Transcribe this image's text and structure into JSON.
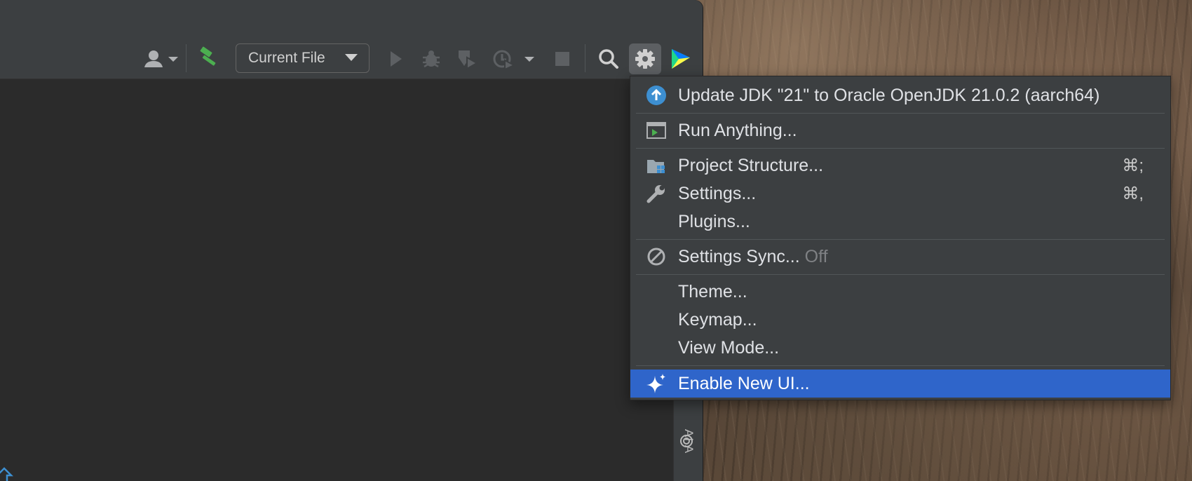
{
  "toolbar": {
    "run_config_label": "Current File",
    "icons": [
      "account-icon",
      "hammer-icon",
      "run-icon",
      "debug-icon",
      "coverage-icon",
      "profile-icon",
      "stop-icon",
      "search-icon",
      "gear-icon",
      "toolbox-icon"
    ]
  },
  "menu": {
    "items": [
      {
        "label": "Update JDK \"21\" to Oracle OpenJDK 21.0.2 (aarch64)",
        "icon": "update-arrow-icon"
      },
      {
        "label": "Run Anything...",
        "icon": "run-anything-icon"
      },
      {
        "label": "Project Structure...",
        "icon": "project-structure-icon",
        "shortcut": "⌘;"
      },
      {
        "label": "Settings...",
        "icon": "wrench-icon",
        "shortcut": "⌘,"
      },
      {
        "label": "Plugins..."
      },
      {
        "label": "Settings Sync...",
        "icon": "disabled-icon",
        "suffix": "Off"
      },
      {
        "label": "Theme..."
      },
      {
        "label": "Keymap..."
      },
      {
        "label": "View Mode..."
      },
      {
        "label": "Enable New UI...",
        "icon": "sparkle-icon"
      }
    ]
  },
  "side_panel": {
    "label": "AI A"
  },
  "colors": {
    "window_bg": "#3c3f41",
    "editor_bg": "#2b2b2b",
    "selection": "#2f65ca",
    "accent_green": "#4caf50",
    "update_blue": "#3d8fd1"
  }
}
